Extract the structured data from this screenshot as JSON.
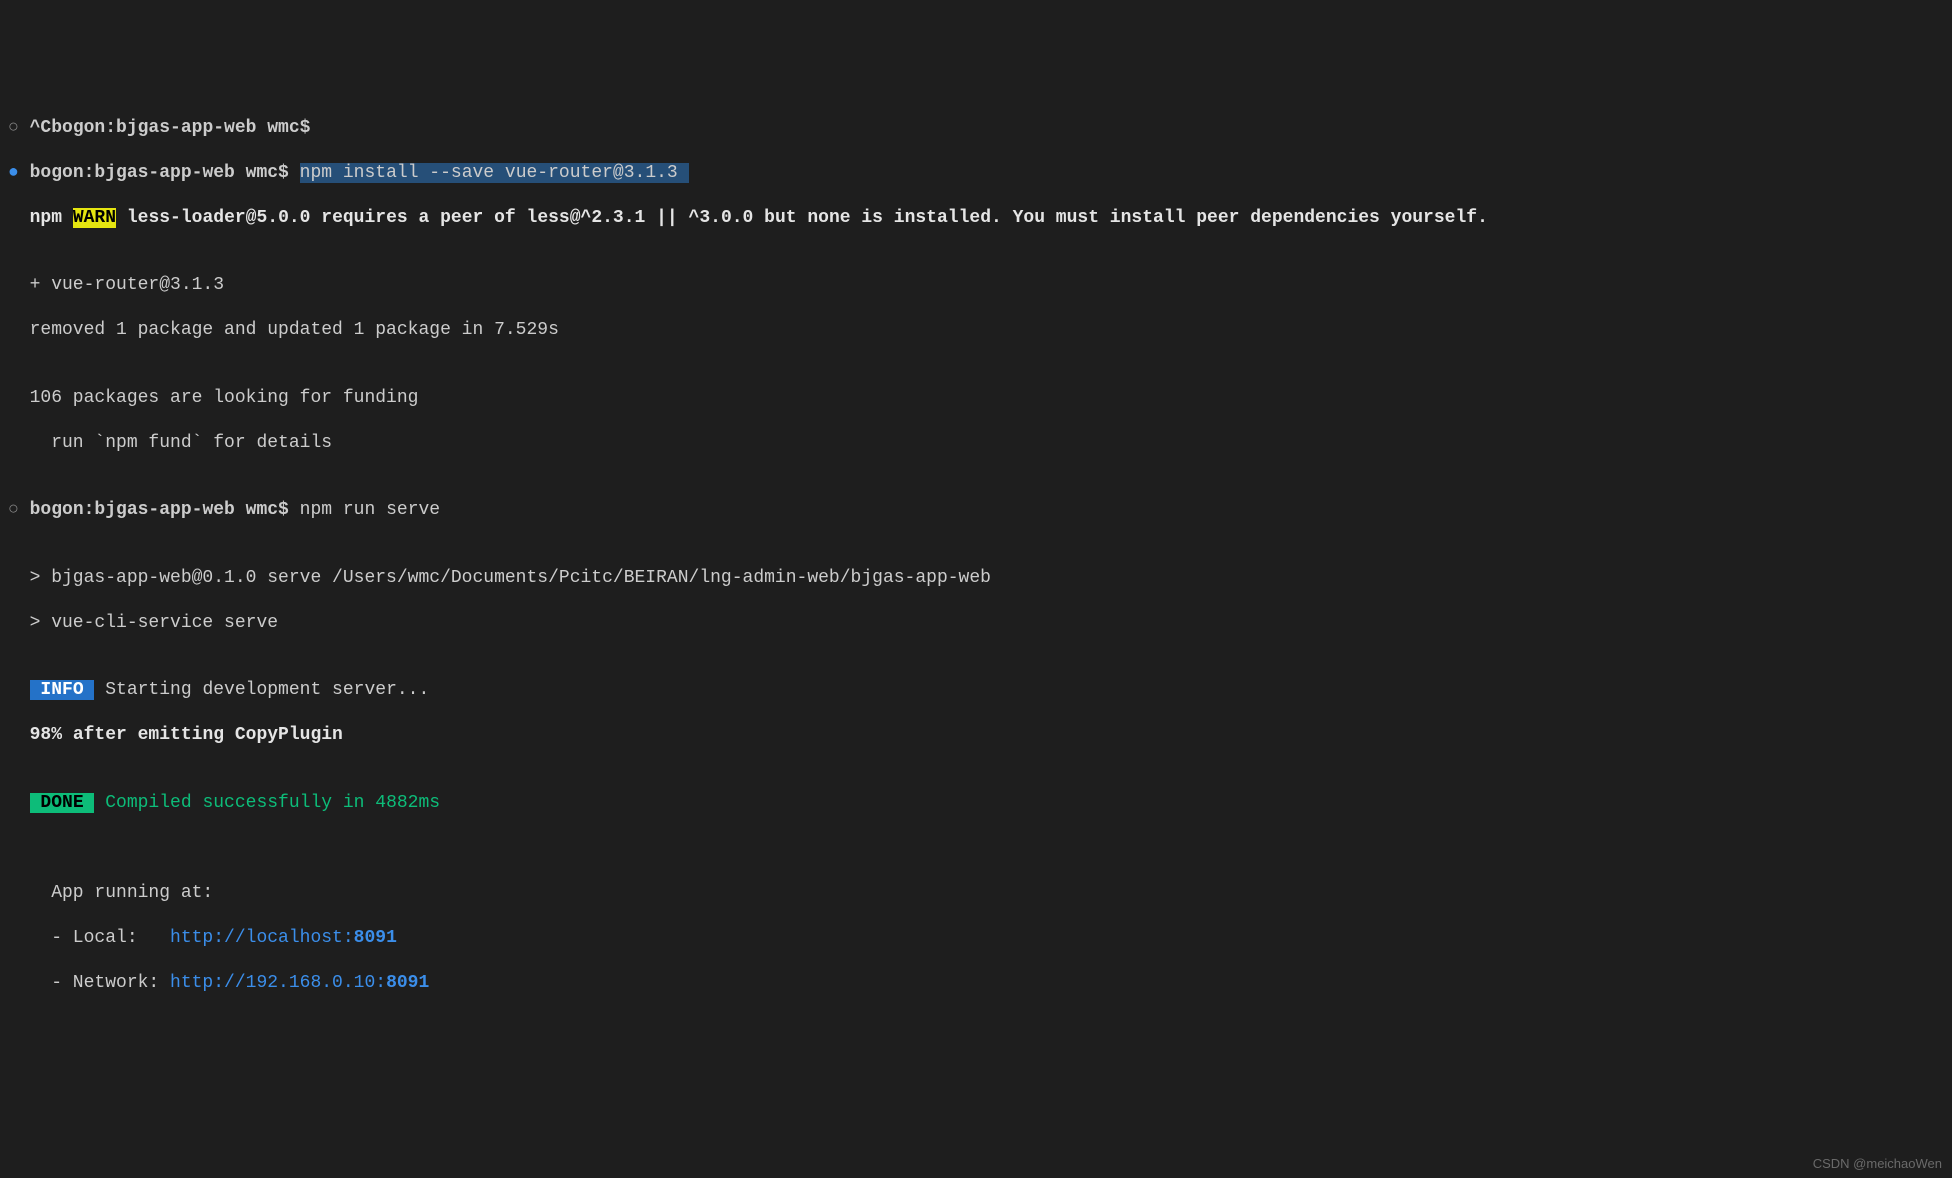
{
  "lines": {
    "l1_bullet": "○",
    "l1_prompt": " ^Cbogon:bjgas-app-web wmc$ ",
    "l2_bullet": "●",
    "l2_prompt": " bogon:bjgas-app-web wmc$ ",
    "l2_cmd": "npm install --save vue-router@3.1.3 ",
    "l3_npm": "npm",
    "l3_warn": "WARN",
    "l3_msg": " less-loader@5.0.0 requires a peer of less@^2.3.1 || ^3.0.0 but none is installed. You must install peer dependencies yourself.",
    "l4_empty": "",
    "l5": "  + vue-router@3.1.3",
    "l6": "  removed 1 package and updated 1 package in 7.529s",
    "l7_empty": "",
    "l8": "  106 packages are looking for funding",
    "l9": "    run `npm fund` for details",
    "l10_empty": "",
    "l11_bullet": "○",
    "l11_prompt": " bogon:bjgas-app-web wmc$ ",
    "l11_cmd": "npm run serve",
    "l12_empty": "",
    "l13": "  > bjgas-app-web@0.1.0 serve /Users/wmc/Documents/Pcitc/BEIRAN/lng-admin-web/bjgas-app-web",
    "l14": "  > vue-cli-service serve",
    "l15_empty": "",
    "l16_info": " INFO ",
    "l16_msg": " Starting development server...",
    "l17": "98% after emitting CopyPlugin",
    "l18_empty": "",
    "l19_done": " DONE ",
    "l19_msg": " Compiled successfully in 4882ms",
    "l20_empty": "",
    "l21_empty": "",
    "l22": "    App running at:",
    "l23_prefix": "    - Local:   ",
    "l23_url": "http://localhost:",
    "l23_port": "8091",
    "l24_prefix": "    - Network: ",
    "l24_url": "http://192.168.0.10:",
    "l24_port": "8091"
  },
  "watermark": "CSDN @meichaoWen"
}
